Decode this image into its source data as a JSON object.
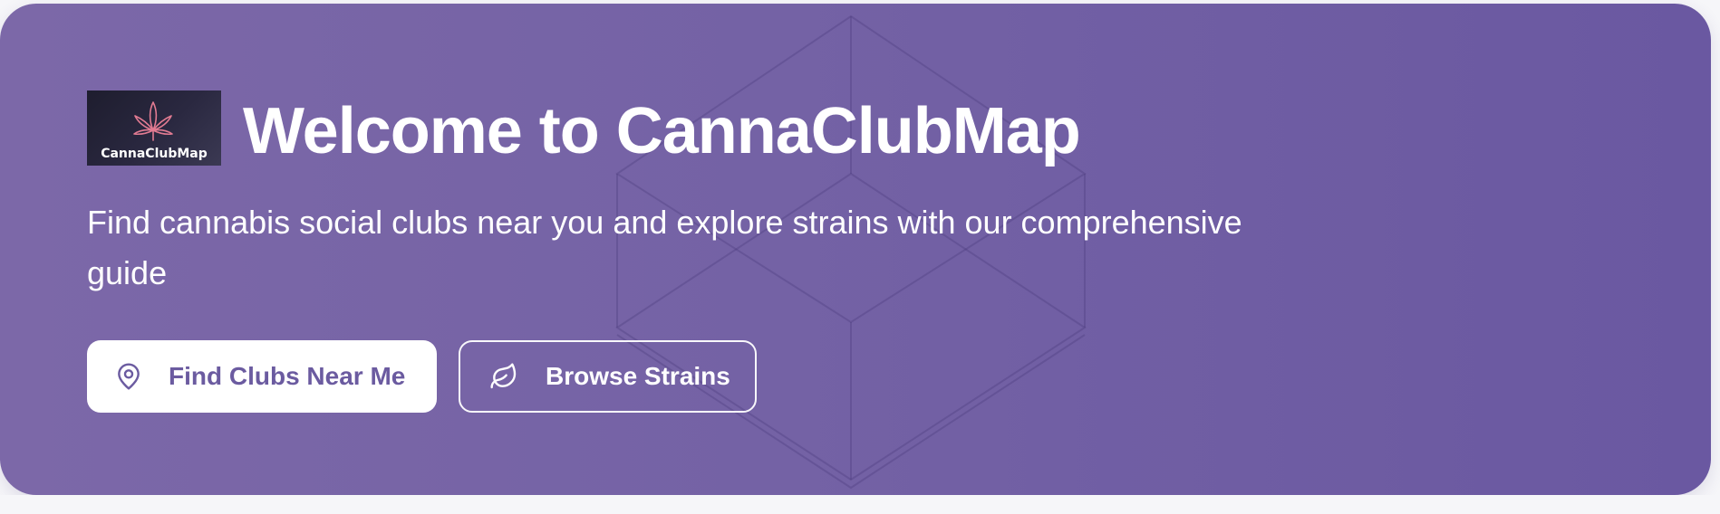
{
  "colors": {
    "hero_start": "#7c68a8",
    "hero_end": "#6a58a1",
    "primary_button_text": "#6b5ba0",
    "logo_leaf": "#e27b92"
  },
  "logo": {
    "text": "CannaClubMap",
    "icon": "cannabis-leaf-icon"
  },
  "hero": {
    "title": "Welcome to CannaClubMap",
    "subtitle": "Find cannabis social clubs near you and explore strains with our comprehensive guide"
  },
  "buttons": {
    "find_clubs": {
      "label": "Find Clubs Near Me",
      "icon": "map-pin-icon"
    },
    "browse_strains": {
      "label": "Browse Strains",
      "icon": "leaf-icon"
    }
  }
}
